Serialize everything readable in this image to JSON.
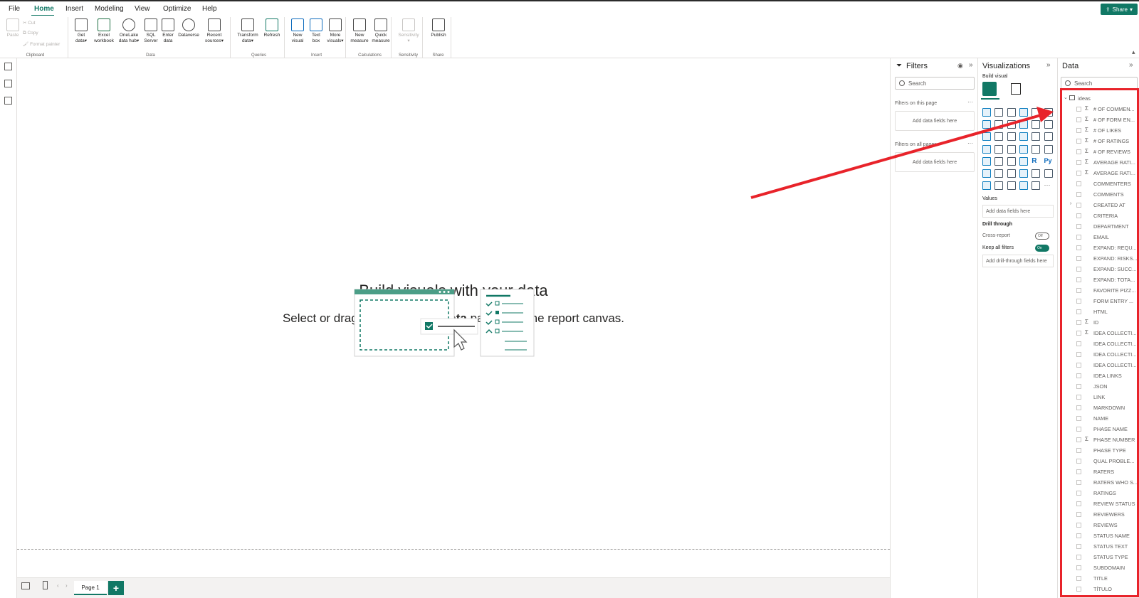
{
  "menu": {
    "file": "File",
    "home": "Home",
    "insert": "Insert",
    "modeling": "Modeling",
    "view": "View",
    "optimize": "Optimize",
    "help": "Help",
    "share": "Share"
  },
  "ribbon": {
    "clipboard": {
      "paste": "Paste",
      "cut": "Cut",
      "copy": "Copy",
      "format_painter": "Format painter",
      "group": "Clipboard"
    },
    "data": {
      "get_data_1": "Get",
      "get_data_2": "data",
      "excel_1": "Excel",
      "excel_2": "workbook",
      "onelake_1": "OneLake",
      "onelake_2": "data hub",
      "sql_1": "SQL",
      "sql_2": "Server",
      "enter_1": "Enter",
      "enter_2": "data",
      "dataverse": "Dataverse",
      "recent_1": "Recent",
      "recent_2": "sources",
      "group": "Data"
    },
    "queries": {
      "transform_1": "Transform",
      "transform_2": "data",
      "refresh": "Refresh",
      "group": "Queries"
    },
    "insert": {
      "new_visual_1": "New",
      "new_visual_2": "visual",
      "text_box_1": "Text",
      "text_box_2": "box",
      "more_1": "More",
      "more_2": "visuals",
      "group": "Insert"
    },
    "calculations": {
      "new_measure_1": "New",
      "new_measure_2": "measure",
      "quick_measure_1": "Quick",
      "quick_measure_2": "measure",
      "group": "Calculations"
    },
    "sensitivity": {
      "label": "Sensitivity",
      "group": "Sensitivity"
    },
    "share": {
      "publish": "Publish",
      "group": "Share"
    }
  },
  "canvas": {
    "title": "Build visuals with your data",
    "sub_before": "Select or drag fields from the ",
    "sub_bold": "Data",
    "sub_after": " pane onto the report canvas."
  },
  "pages": {
    "page1": "Page 1",
    "add": "+"
  },
  "filters": {
    "title": "Filters",
    "search": "Search",
    "on_page": "Filters on this page",
    "on_all": "Filters on all pages",
    "add_fields": "Add data fields here"
  },
  "visualizations": {
    "title": "Visualizations",
    "build_visual": "Build visual",
    "values": "Values",
    "add_fields": "Add data fields here",
    "drill_through": "Drill through",
    "cross_report": "Cross-report",
    "cross_report_state": "Off",
    "keep_filters": "Keep all filters",
    "keep_filters_state": "On",
    "add_drill": "Add drill-through fields here",
    "r_label": "R",
    "py_label": "Py"
  },
  "data_pane": {
    "title": "Data",
    "search": "Search",
    "table": "ideas",
    "fields": [
      {
        "name": "# OF COMMEN...",
        "sigma": true
      },
      {
        "name": "# OF FORM EN...",
        "sigma": true
      },
      {
        "name": "# OF LIKES",
        "sigma": true
      },
      {
        "name": "# OF RATINGS",
        "sigma": true
      },
      {
        "name": "# OF REVIEWS",
        "sigma": true
      },
      {
        "name": "AVERAGE RATI...",
        "sigma": true
      },
      {
        "name": "AVERAGE RATI...",
        "sigma": true
      },
      {
        "name": "COMMENTERS",
        "sigma": false
      },
      {
        "name": "COMMENTS",
        "sigma": false
      },
      {
        "name": "CREATED AT",
        "sigma": false,
        "expand": true
      },
      {
        "name": "CRITERIA",
        "sigma": false
      },
      {
        "name": "DEPARTMENT",
        "sigma": false
      },
      {
        "name": "EMAIL",
        "sigma": false
      },
      {
        "name": "EXPAND: REQU...",
        "sigma": false
      },
      {
        "name": "EXPAND: RISKS...",
        "sigma": false
      },
      {
        "name": "EXPAND: SUCC...",
        "sigma": false
      },
      {
        "name": "EXPAND: TOTA...",
        "sigma": false
      },
      {
        "name": "FAVORITE PIZZ...",
        "sigma": false
      },
      {
        "name": "FORM ENTRY ...",
        "sigma": false
      },
      {
        "name": "HTML",
        "sigma": false
      },
      {
        "name": "ID",
        "sigma": true
      },
      {
        "name": "IDEA COLLECTI...",
        "sigma": true
      },
      {
        "name": "IDEA COLLECTI...",
        "sigma": false
      },
      {
        "name": "IDEA COLLECTI...",
        "sigma": false
      },
      {
        "name": "IDEA COLLECTI...",
        "sigma": false
      },
      {
        "name": "IDEA LINKS",
        "sigma": false
      },
      {
        "name": "JSON",
        "sigma": false
      },
      {
        "name": "LINK",
        "sigma": false
      },
      {
        "name": "MARKDOWN",
        "sigma": false
      },
      {
        "name": "NAME",
        "sigma": false
      },
      {
        "name": "PHASE NAME",
        "sigma": false
      },
      {
        "name": "PHASE NUMBER",
        "sigma": true
      },
      {
        "name": "PHASE TYPE",
        "sigma": false
      },
      {
        "name": "QUAL PROBLE...",
        "sigma": false
      },
      {
        "name": "RATERS",
        "sigma": false
      },
      {
        "name": "RATERS WHO S...",
        "sigma": false
      },
      {
        "name": "RATINGS",
        "sigma": false
      },
      {
        "name": "REVIEW STATUS",
        "sigma": false
      },
      {
        "name": "REVIEWERS",
        "sigma": false
      },
      {
        "name": "REVIEWS",
        "sigma": false
      },
      {
        "name": "STATUS NAME",
        "sigma": false
      },
      {
        "name": "STATUS TEXT",
        "sigma": false
      },
      {
        "name": "STATUS TYPE",
        "sigma": false
      },
      {
        "name": "SUBDOMAIN",
        "sigma": false
      },
      {
        "name": "TITLE",
        "sigma": false
      },
      {
        "name": "TÍTULO",
        "sigma": false
      }
    ]
  },
  "colors": {
    "accent": "#117865",
    "annotation": "#e8232a"
  }
}
